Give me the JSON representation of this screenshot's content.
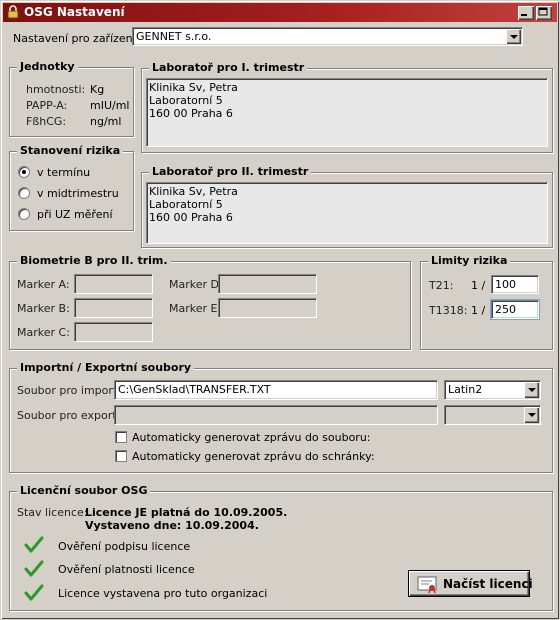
{
  "window": {
    "title": "OSG Nastavení"
  },
  "device": {
    "label": "Nastavení pro zařízení",
    "value": "GENNET s.r.o."
  },
  "units": {
    "title": "Jednotky",
    "rows": [
      {
        "name": "hmotnosti:",
        "unit": "Kg"
      },
      {
        "name": "PAPP-A:",
        "unit": "mIU/ml"
      },
      {
        "name": "FßhCG:",
        "unit": "ng/ml"
      }
    ]
  },
  "lab1": {
    "title": "Laboratoř pro I. trimestr",
    "lines": [
      "Klinika Sv, Petra",
      "Laboratorní 5",
      "160 00 Praha 6"
    ]
  },
  "lab2": {
    "title": "Laboratoř pro II. trimestr",
    "lines": [
      "Klinika Sv, Petra",
      "Laboratorní 5",
      "160 00 Praha 6"
    ]
  },
  "risk": {
    "title": "Stanovení rizika",
    "options": [
      "v termínu",
      "v midtrimestru",
      "při UZ měření"
    ],
    "selected": 0
  },
  "biometry": {
    "title": "Biometrie B pro II. trim.",
    "markers": {
      "a": "Marker A:",
      "b": "Marker B:",
      "c": "Marker C:",
      "d": "Marker D:",
      "e": "Marker E:"
    }
  },
  "limits": {
    "title": "Limity rizika",
    "t21": {
      "label": "T21:",
      "prefix": "1 /",
      "value": "100"
    },
    "t1318": {
      "label": "T1318:",
      "prefix": "1 /",
      "value": "250"
    }
  },
  "files": {
    "title": "Importní / Exportní soubory",
    "import_label": "Soubor pro import:",
    "import_value": "C:\\GenSklad\\TRANSFER.TXT",
    "import_encoding": "Latin2",
    "export_label": "Soubor pro export:",
    "export_value": "",
    "export_encoding": "",
    "auto_file": "Automaticky generovat zprávu do souboru:",
    "auto_mailbox": "Automaticky generovat zprávu do schránky:"
  },
  "license": {
    "title": "Licenční soubor OSG",
    "status_label": "Stav licence:",
    "status_line1": "Licence JE platná do 10.09.2005.",
    "status_line2": "Vystaveno dne: 10.09.2004.",
    "checks": [
      "Ověření podpisu licence",
      "Ověření platnosti licence",
      "Licence vystavena pro tuto organizaci"
    ],
    "load_button": "Načíst licenci"
  },
  "colors": {
    "title_bar": "#a82020",
    "tick": "#2a9a2a",
    "face": "#d4d0c8"
  }
}
